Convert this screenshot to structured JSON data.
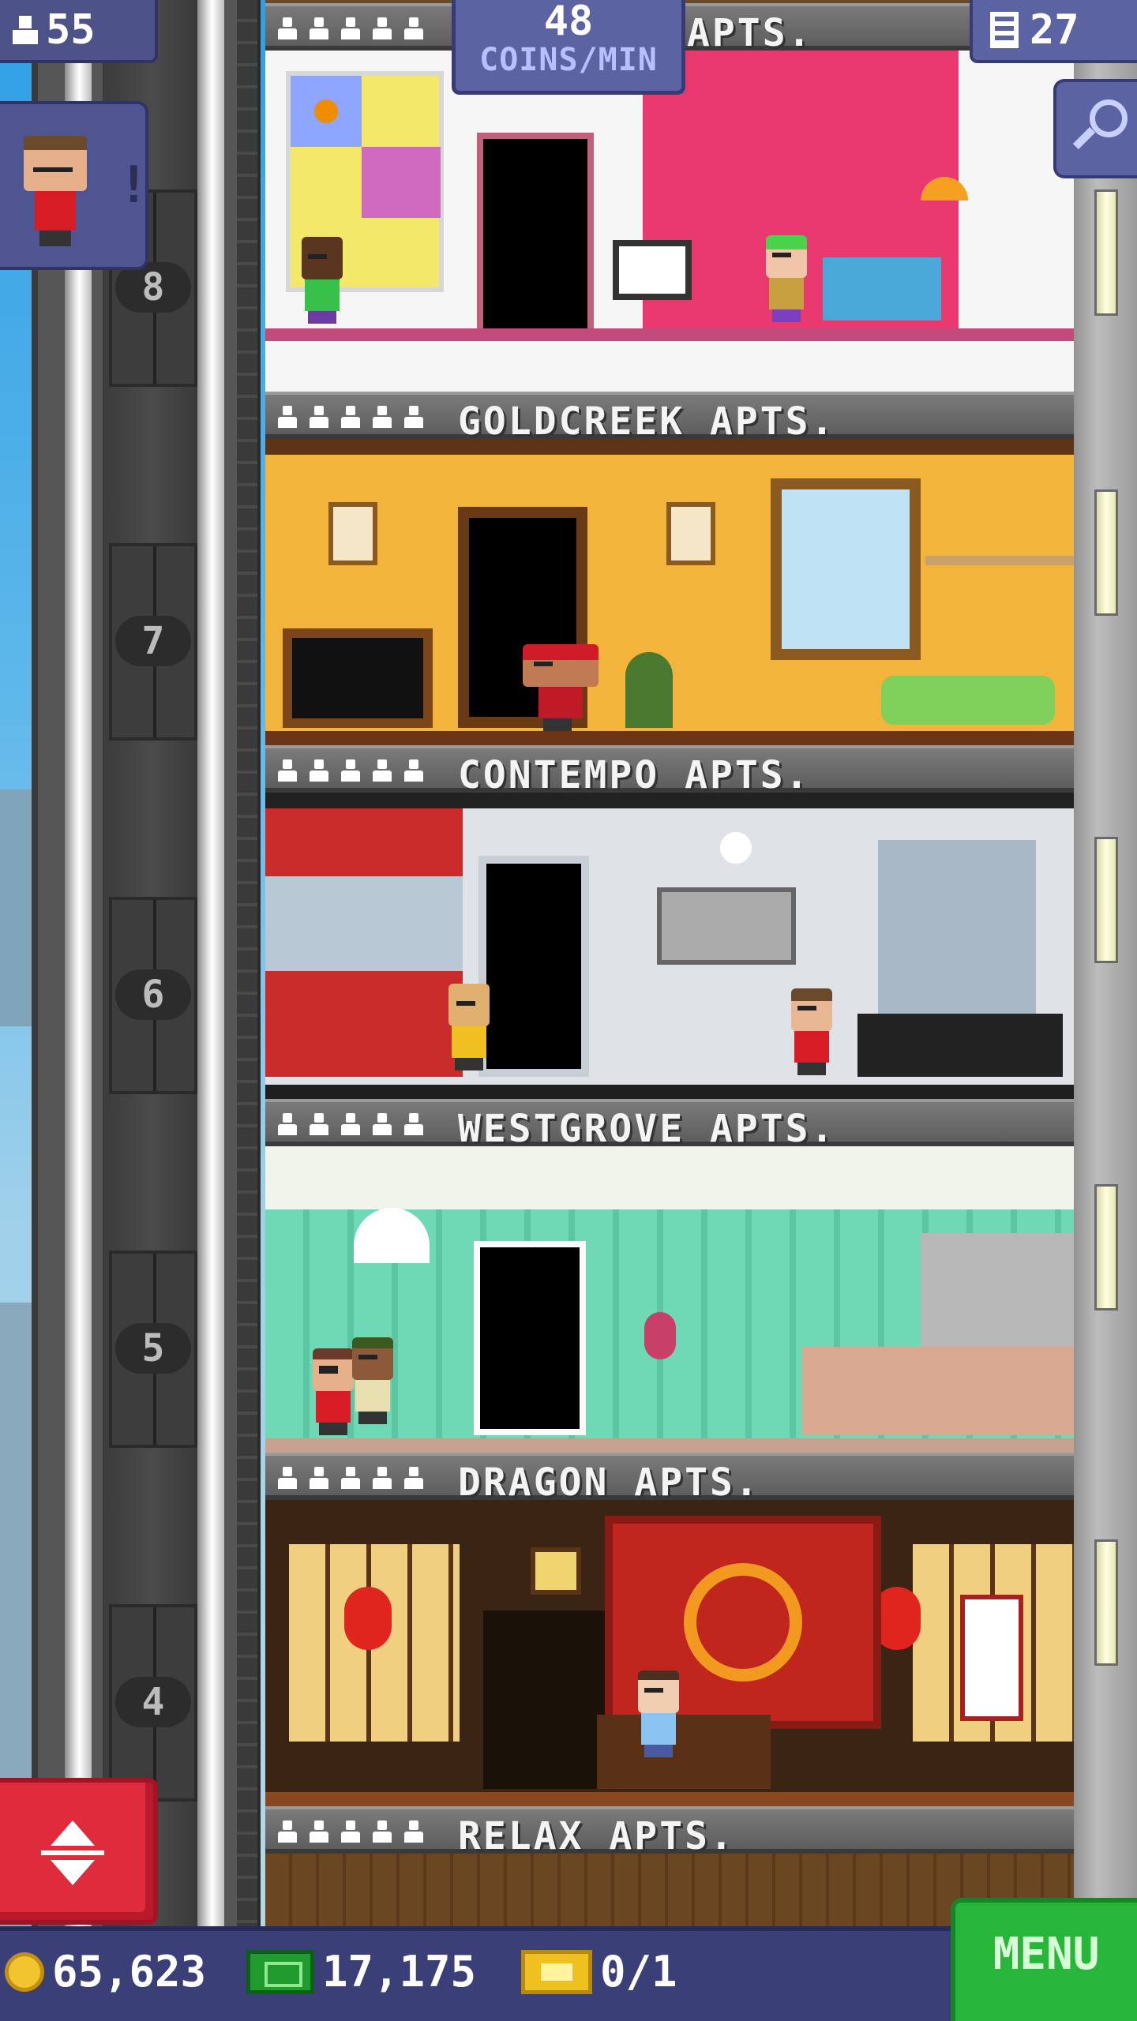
{
  "hud": {
    "population": "55",
    "coins_rate": "48",
    "coins_unit": "COINS/MIN",
    "floor_count": "27"
  },
  "tower": {
    "top_floor_label_suffix": "APTS.",
    "elevator_floor_numbers": [
      "8",
      "7",
      "6",
      "5",
      "4"
    ],
    "floors": [
      {
        "name": "GOLDCREEK APTS.",
        "stars": 5
      },
      {
        "name": "CONTEMPO APTS.",
        "stars": 5
      },
      {
        "name": "WESTGROVE APTS.",
        "stars": 5
      },
      {
        "name": "DRAGON APTS.",
        "stars": 5
      },
      {
        "name": "RELAX APTS.",
        "stars": 5
      }
    ]
  },
  "bottom_bar": {
    "coins": "65,623",
    "bux": "17,175",
    "tickets": "0/1",
    "menu_label": "MENU"
  },
  "icons": {
    "population": "person-icon",
    "floors": "building-icon",
    "search": "magnifier-icon",
    "elevator": "up-down-arrows-icon",
    "coins": "coin-icon",
    "bux": "bux-icon",
    "tickets": "ticket-icon"
  },
  "colors": {
    "hud_panel": "#5c63a3",
    "elevator_button": "#e02b3c",
    "menu_button": "#27b53a",
    "label_bar": "#6a6a6a"
  }
}
